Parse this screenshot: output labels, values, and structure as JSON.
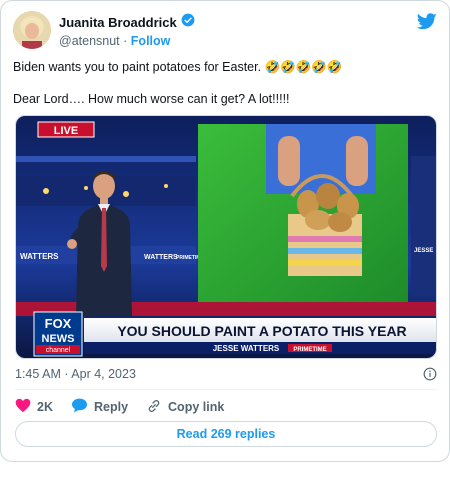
{
  "author": {
    "display_name": "Juanita Broaddrick",
    "handle": "@atensnut",
    "follow_label": "Follow",
    "separator": "·"
  },
  "tweet": {
    "line1": "Biden wants you to paint potatoes for Easter. 🤣🤣🤣🤣🤣",
    "line2": "Dear Lord…. How much worse can it get?   A lot!!!!!"
  },
  "media": {
    "live_label": "LIVE",
    "headline": "YOU SHOULD PAINT A POTATO THIS YEAR",
    "show": "JESSE WATTERS",
    "show_badge": "PRIMETIME",
    "logo_top": "FOX",
    "logo_mid": "NEWS",
    "logo_bottom": "channel",
    "wall_text": "WATTERS",
    "wall_text2": "WATTERS",
    "wall_badge": "PRIMETIME",
    "side_text": "JESSE"
  },
  "meta": {
    "timestamp": "1:45 AM · Apr 4, 2023"
  },
  "actions": {
    "likes": "2K",
    "reply": "Reply",
    "copy_link": "Copy link"
  },
  "read_replies": "Read 269 replies",
  "colors": {
    "twitter_blue": "#1d9bf0",
    "like_pink": "#f91880",
    "fox_red": "#c8102e",
    "fox_blue": "#003a8c"
  }
}
